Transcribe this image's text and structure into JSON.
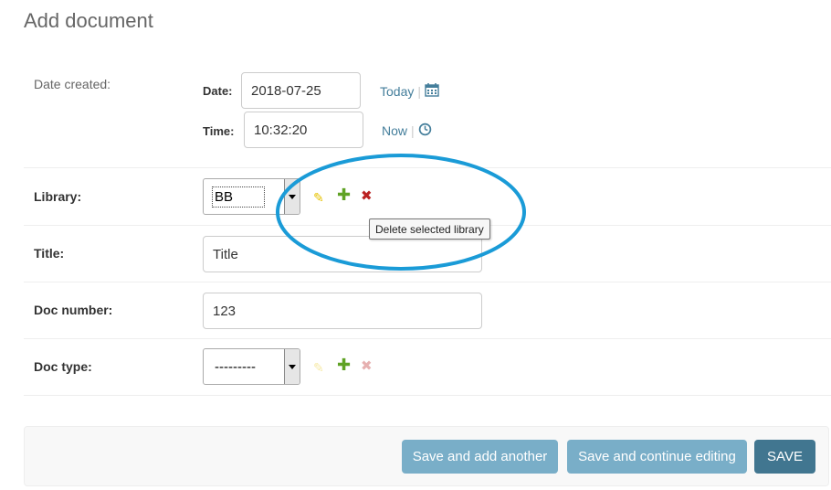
{
  "page": {
    "title": "Add document"
  },
  "date_created": {
    "label": "Date created:",
    "date_label": "Date:",
    "date_value": "2018-07-25",
    "today_link": "Today",
    "calendar_icon": "calendar-icon",
    "time_label": "Time:",
    "time_value": "10:32:20",
    "now_link": "Now",
    "clock_icon": "clock-icon",
    "separator": "|"
  },
  "library": {
    "label": "Library:",
    "selected": "BB",
    "edit_icon": "pencil-icon",
    "add_icon": "plus-icon",
    "delete_icon": "x-icon",
    "tooltip": "Delete selected library"
  },
  "title_field": {
    "label": "Title:",
    "value": "Title"
  },
  "doc_number": {
    "label": "Doc number:",
    "value": "123"
  },
  "doc_type": {
    "label": "Doc type:",
    "selected": "---------",
    "edit_icon": "pencil-icon",
    "add_icon": "plus-icon",
    "delete_icon": "x-icon"
  },
  "actions": {
    "save_add_another": "Save and add another",
    "save_continue": "Save and continue editing",
    "save": "SAVE"
  },
  "colors": {
    "link": "#447e9b",
    "button_light": "#79aec8",
    "button_default": "#417690",
    "annotation": "#1a9bd7",
    "delete": "#ba2121",
    "add": "#5fa225",
    "edit": "#e6c200"
  }
}
